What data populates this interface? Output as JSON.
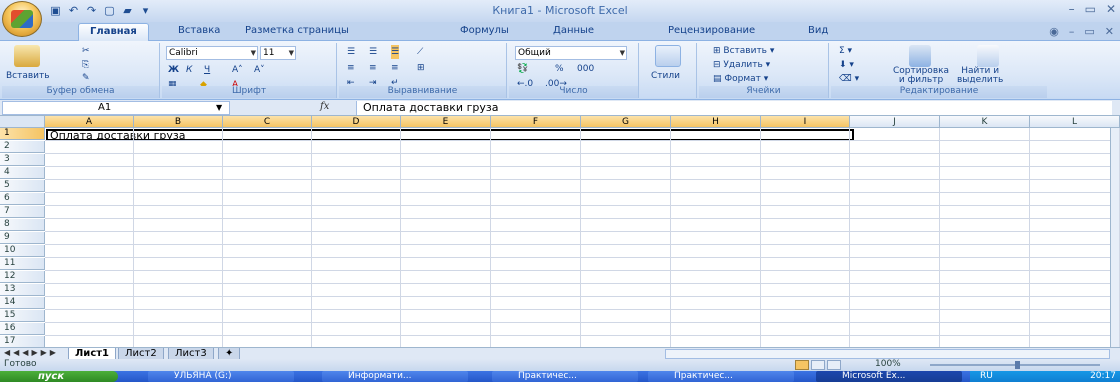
{
  "window": {
    "title": "Книга1 - Microsoft Excel"
  },
  "ribbon": {
    "tabs": [
      "Главная",
      "Вставка",
      "Разметка страницы",
      "Формулы",
      "Данные",
      "Рецензирование",
      "Вид"
    ],
    "active_tab": "Главная",
    "clipboard": {
      "paste": "Вставить",
      "label": "Буфер обмена"
    },
    "font": {
      "name": "Calibri",
      "size": "11",
      "label": "Шрифт"
    },
    "alignment": {
      "label": "Выравнивание"
    },
    "number": {
      "format": "Общий",
      "percent": "%",
      "thousands": "000",
      "label": "Число"
    },
    "styles": {
      "label": "Стили"
    },
    "cells": {
      "insert": "Вставить",
      "delete": "Удалить",
      "format": "Формат",
      "label": "Ячейки"
    },
    "editing": {
      "sort": "Сортировка",
      "sort2": "и фильтр",
      "find": "Найти и",
      "find2": "выделить",
      "label": "Редактирование"
    }
  },
  "formula_bar": {
    "name_box": "A1",
    "fx": "fx",
    "content": "Оплата доставки груза"
  },
  "grid": {
    "columns": [
      "A",
      "B",
      "C",
      "D",
      "E",
      "F",
      "G",
      "H",
      "I",
      "J",
      "K",
      "L"
    ],
    "rows": [
      "1",
      "2",
      "3",
      "4",
      "5",
      "6",
      "7",
      "8",
      "9",
      "10",
      "11",
      "12",
      "13",
      "14",
      "15",
      "16",
      "17"
    ],
    "cell_a1": "Оплата доставки груза"
  },
  "sheets": {
    "tabs": [
      "Лист1",
      "Лист2",
      "Лист3"
    ],
    "active": "Лист1"
  },
  "status": {
    "ready": "Готово",
    "zoom": "100%"
  },
  "taskbar": {
    "start": "пуск",
    "tasks": [
      "УЛЬЯНА (G:)",
      "Информати...",
      "Практичес...",
      "Практичес...",
      "Microsoft Ex..."
    ],
    "lang": "RU",
    "clock": "20:17"
  },
  "colors": {
    "ribbon_blue": "#dbe7f7",
    "selection_header": "#f5c463",
    "taskbar": "#2456c8",
    "start_green": "#2e8a24"
  }
}
